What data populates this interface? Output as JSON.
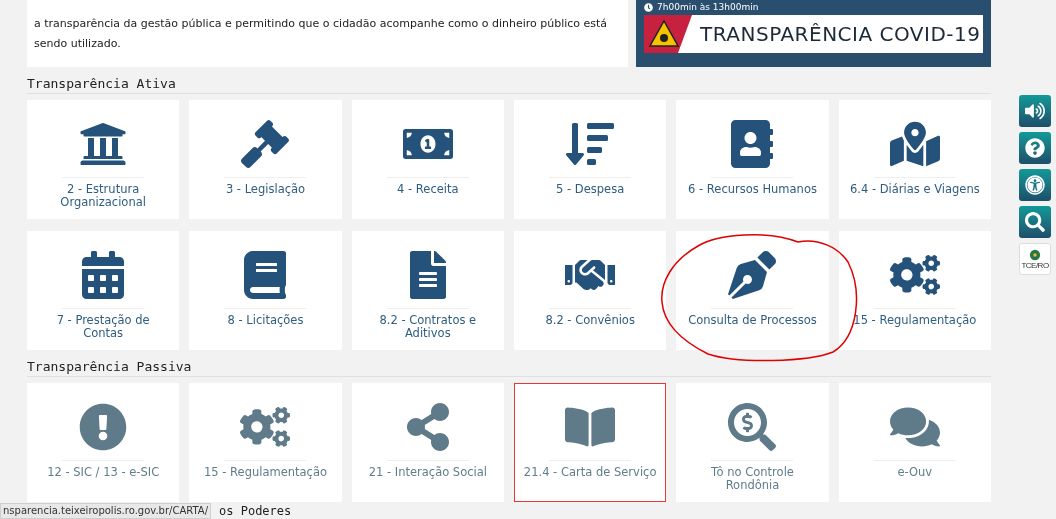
{
  "intro": {
    "text": "a transparência da gestão pública e permitindo que o cidadão acompanhe como o dinheiro público está sendo utilizado."
  },
  "banner": {
    "hours": "7h00min às 13h00min",
    "title": "TRANSPARÊNCIA COVID-19"
  },
  "sections": [
    {
      "heading": "Transparência Ativa",
      "kind": "active",
      "tiles": [
        {
          "label": "2 - Estrutura Organizacional",
          "highlighted": false
        },
        {
          "label": "3 - Legislação",
          "highlighted": false
        },
        {
          "label": "4 - Receita",
          "highlighted": false
        },
        {
          "label": "5 - Despesa",
          "highlighted": false
        },
        {
          "label": "6 - Recursos Humanos",
          "highlighted": false
        },
        {
          "label": "6.4 - Diárias e Viagens",
          "highlighted": false
        },
        {
          "label": "7 - Prestação de Contas",
          "highlighted": false
        },
        {
          "label": "8 - Licitações",
          "highlighted": false
        },
        {
          "label": "8.2 - Contratos e Aditivos",
          "highlighted": false
        },
        {
          "label": "8.2 - Convênios",
          "highlighted": false
        },
        {
          "label": "Consulta de Processos",
          "highlighted": false
        },
        {
          "label": "15 - Regulamentação",
          "highlighted": false
        }
      ]
    },
    {
      "heading": "Transparência Passiva",
      "kind": "passive",
      "tiles": [
        {
          "label": "12 - SIC / 13 - e-SIC",
          "highlighted": false
        },
        {
          "label": "15 - Regulamentação",
          "highlighted": false
        },
        {
          "label": "21 - Interação Social",
          "highlighted": false
        },
        {
          "label": "21.4 - Carta de Serviço",
          "highlighted": true
        },
        {
          "label": "Tô no Controle Rondônia",
          "highlighted": false
        },
        {
          "label": "e-Ouv",
          "highlighted": false
        }
      ]
    }
  ],
  "next_heading": "os Poderes",
  "status_bar": "nsparencia.teixeiropolis.ro.gov.br/CARTA/",
  "side_toolbar": {
    "logo_text": "TCE/RO"
  }
}
